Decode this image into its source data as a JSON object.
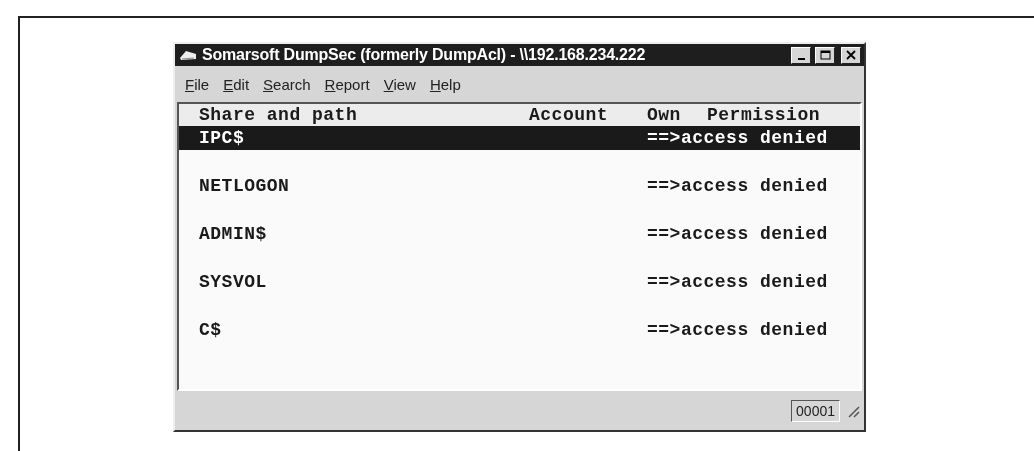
{
  "window": {
    "title": "Somarsoft DumpSec (formerly DumpAcl) - \\\\192.168.234.222"
  },
  "menu": [
    "File",
    "Edit",
    "Search",
    "Report",
    "View",
    "Help"
  ],
  "table": {
    "columns": [
      "Share and path",
      "Account",
      "Own",
      "Permission"
    ],
    "rows": [
      {
        "share": "IPC$",
        "permission": "==>access denied",
        "selected": true
      },
      {
        "share": "NETLOGON",
        "permission": "==>access denied",
        "selected": false
      },
      {
        "share": "ADMIN$",
        "permission": "==>access denied",
        "selected": false
      },
      {
        "share": "SYSVOL",
        "permission": "==>access denied",
        "selected": false
      },
      {
        "share": "C$",
        "permission": "==>access denied",
        "selected": false
      }
    ]
  },
  "status_bar": {
    "count": "00001"
  }
}
